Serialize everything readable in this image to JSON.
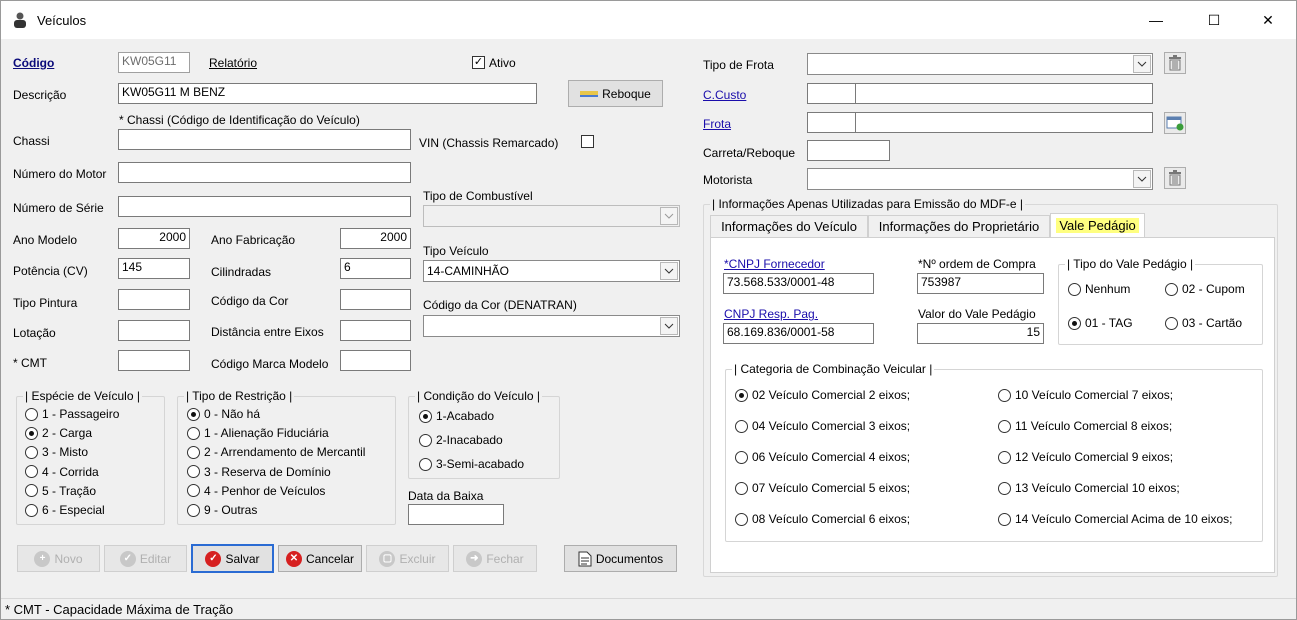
{
  "window": {
    "title": "Veículos",
    "minimize": "—",
    "maximize": "☐",
    "close": "✕"
  },
  "left": {
    "codigo_label": "Código",
    "codigo_value": "KW05G11",
    "relatorio": "Relatório",
    "ativo_label": "Ativo",
    "descricao_label": "Descrição",
    "descricao_value": "KW05G11 M BENZ",
    "reboque_button": "Reboque",
    "chassi_hint": "* Chassi (Código de Identificação do Veículo)",
    "chassi_label": "Chassi",
    "vin_label": "VIN (Chassis Remarcado)",
    "motor_label": "Número do Motor",
    "serie_label": "Número de Série",
    "combustivel_label": "Tipo de Combustível",
    "ano_modelo_label": "Ano Modelo",
    "ano_modelo_value": "2000",
    "ano_fab_label": "Ano Fabricação",
    "ano_fab_value": "2000",
    "tipo_veiculo_label": "Tipo Veículo",
    "tipo_veiculo_value": "14-CAMINHÃO",
    "potencia_label": "Potência (CV)",
    "potencia_value": "145",
    "cilindradas_label": "Cilindradas",
    "cilindradas_value": "6",
    "pintura_label": "Tipo Pintura",
    "cor_label": "Código da Cor",
    "cor_denatran_label": "Código da Cor (DENATRAN)",
    "lotacao_label": "Lotação",
    "eixos_label": "Distância entre Eixos",
    "cmt_label": "* CMT",
    "marca_label": "Código Marca Modelo",
    "especie": {
      "title": "Espécie de Veículo",
      "items": [
        "1 - Passageiro",
        "2 - Carga",
        "3 - Misto",
        "4 - Corrida",
        "5 - Tração",
        "6 - Especial"
      ],
      "selected": 1
    },
    "restricao": {
      "title": "Tipo de Restrição",
      "items": [
        "0 - Não há",
        "1 - Alienação Fiduciária",
        "2 - Arrendamento de Mercantil",
        "3 - Reserva de Domínio",
        "4 - Penhor de Veículos",
        "9 - Outras"
      ],
      "selected": 0
    },
    "condicao": {
      "title": "Condição do Veículo",
      "items": [
        "1-Acabado",
        "2-Inacabado",
        "3-Semi-acabado"
      ],
      "selected": 0
    },
    "baixa_label": "Data da Baixa"
  },
  "buttons": {
    "novo": "Novo",
    "editar": "Editar",
    "salvar": "Salvar",
    "cancelar": "Cancelar",
    "excluir": "Excluir",
    "fechar": "Fechar",
    "documentos": "Documentos"
  },
  "right": {
    "frota_tipo_label": "Tipo de Frota",
    "ccusto_label": "C.Custo",
    "frota_label": "Frota",
    "carreta_label": "Carreta/Reboque",
    "motorista_label": "Motorista",
    "mdfe_title": "Informações Apenas Utilizadas para Emissão do MDF-e",
    "tabs": [
      "Informações do Veículo",
      "Informações do Proprietário",
      "Vale Pedágio"
    ],
    "cnpj_fornecedor_label": "*CNPJ Fornecedor",
    "cnpj_fornecedor_value": "73.568.533/0001-48",
    "ordem_label": "*Nº ordem de Compra",
    "ordem_value": "753987",
    "cnpj_resp_label": "CNPJ Resp. Pag.",
    "cnpj_resp_value": "68.169.836/0001-58",
    "valor_label": "Valor do Vale Pedágio",
    "valor_value": "15",
    "tipo_vale": {
      "title": "Tipo do Vale Pedágio",
      "items": [
        "Nenhum",
        "02 - Cupom",
        "01 - TAG",
        "03 - Cartão"
      ],
      "selected": 2
    },
    "categoria": {
      "title": "Categoria de Combinação Veicular",
      "left": [
        "02 Veículo Comercial 2 eixos;",
        "04 Veículo Comercial 3 eixos;",
        "06 Veículo Comercial 4 eixos;",
        "07 Veículo Comercial 5 eixos;",
        "08 Veículo Comercial 6 eixos;"
      ],
      "right": [
        "10 Veículo Comercial 7 eixos;",
        "11 Veículo Comercial 8 eixos;",
        "12 Veículo Comercial 9 eixos;",
        "13 Veículo Comercial 10 eixos;",
        "14 Veículo Comercial Acima de 10 eixos;"
      ],
      "selected_left": 0
    }
  },
  "status_text": "* CMT - Capacidade Máxima de Tração",
  "colors": {
    "accent": "#2a6bd3",
    "link": "#1a0dab",
    "tab_active": "#ffff80"
  }
}
